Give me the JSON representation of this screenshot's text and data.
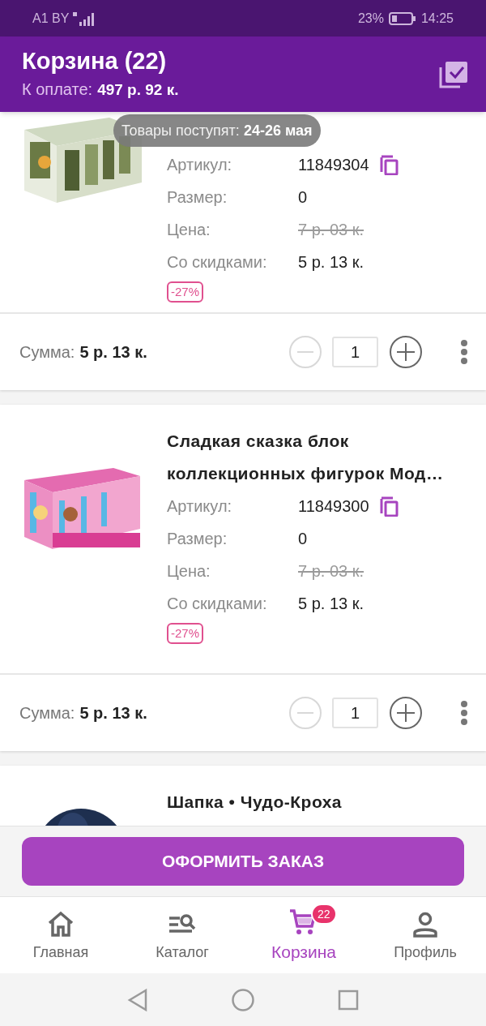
{
  "status_bar": {
    "carrier": "A1 BY",
    "battery": "23%",
    "time": "14:25"
  },
  "header": {
    "title": "Корзина (22)",
    "total_label": "К оплате:",
    "total_value": "497 р. 92 к."
  },
  "toast": {
    "label": "Товары поступят:",
    "value": "24-26 мая"
  },
  "cards": [
    {
      "details": [
        {
          "label": "Артикул:",
          "value": "11849304",
          "kind": "article"
        },
        {
          "label": "Размер:",
          "value": "0",
          "kind": "plain"
        },
        {
          "label": "Цена:",
          "value": "7 р. 03 к.",
          "kind": "old"
        },
        {
          "label": "Со скидками:",
          "value": "5 р. 13 к.",
          "kind": "plain"
        }
      ],
      "discount": "-27%",
      "sum_label": "Сумма:",
      "sum_value": "5 р. 13 к.",
      "quantity": "1",
      "decrement_disabled": true
    },
    {
      "title": "Сладкая сказка блок коллекционных фигурок Мод…",
      "details": [
        {
          "label": "Артикул:",
          "value": "11849300",
          "kind": "article"
        },
        {
          "label": "Размер:",
          "value": "0",
          "kind": "plain"
        },
        {
          "label": "Цена:",
          "value": "7 р. 03 к.",
          "kind": "old"
        },
        {
          "label": "Со скидками:",
          "value": "5 р. 13 к.",
          "kind": "plain"
        }
      ],
      "discount": "-27%",
      "sum_label": "Сумма:",
      "sum_value": "5 р. 13 к.",
      "quantity": "1",
      "decrement_disabled": true
    },
    {
      "title": "Шапка • Чудо-Кроха"
    }
  ],
  "checkout_button": "ОФОРМИТЬ ЗАКАЗ",
  "nav": [
    {
      "label": "Главная",
      "selected": false
    },
    {
      "label": "Каталог",
      "selected": false
    },
    {
      "label": "Корзина",
      "selected": true,
      "badge": "22"
    },
    {
      "label": "Профиль",
      "selected": false
    }
  ]
}
